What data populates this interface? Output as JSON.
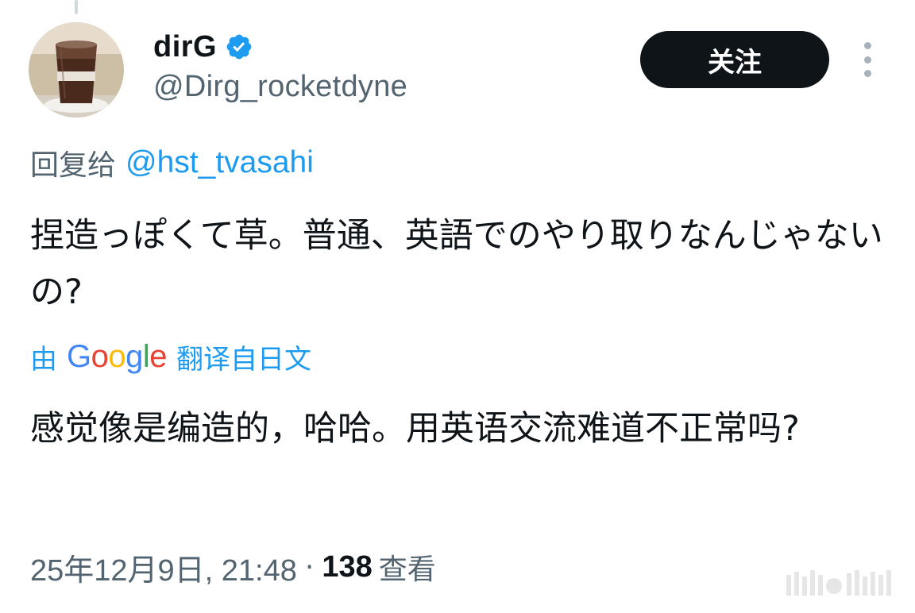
{
  "author": {
    "display_name": "dirG",
    "handle": "@Dirg_rocketdyne",
    "verified": true,
    "avatar": "iced-coffee-cup-photo"
  },
  "actions": {
    "follow_label": "关注",
    "more_icon": "more-vertical-icon"
  },
  "reply": {
    "prefix": "回复给",
    "handle": "@hst_tvasahi"
  },
  "tweet": {
    "text": "捏造っぽくて草。普通、英語でのやり取りなんじゃないの?"
  },
  "translation": {
    "prefix": "由",
    "provider": "Google",
    "suffix": "翻译自日文",
    "text": "感觉像是编造的，哈哈。用英语交流难道不正常吗?"
  },
  "meta": {
    "timestamp": "25年12月9日, 21:48",
    "separator": "·",
    "views_count": "138",
    "views_label": "查看"
  },
  "colors": {
    "text": "#0f1419",
    "secondary": "#536471",
    "accent": "#1d9bf0",
    "button_bg": "#0f1419"
  }
}
